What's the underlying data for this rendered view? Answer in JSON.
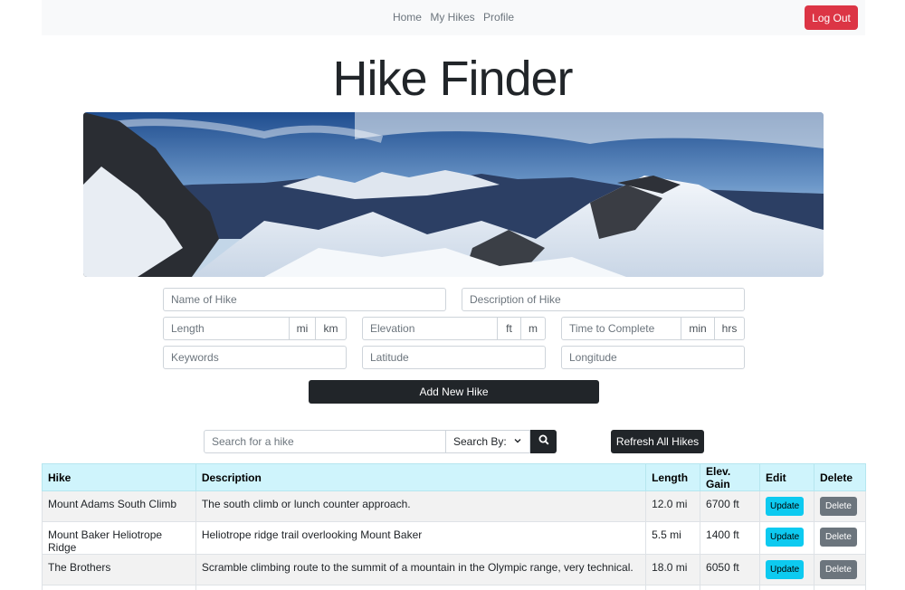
{
  "nav": {
    "links": [
      "Home",
      "My Hikes",
      "Profile"
    ],
    "logout_label": "Log Out"
  },
  "page_title": "Hike Finder",
  "form": {
    "name_placeholder": "Name of Hike",
    "description_placeholder": "Description of Hike",
    "length_placeholder": "Length",
    "length_units": [
      "mi",
      "km"
    ],
    "elevation_placeholder": "Elevation",
    "elevation_units": [
      "ft",
      "m"
    ],
    "time_placeholder": "Time to Complete",
    "time_units": [
      "min",
      "hrs"
    ],
    "keywords_placeholder": "Keywords",
    "latitude_placeholder": "Latitude",
    "longitude_placeholder": "Longitude",
    "add_label": "Add New Hike"
  },
  "search": {
    "placeholder": "Search for a hike",
    "select_label": "Search By:",
    "refresh_label": "Refresh All Hikes"
  },
  "table": {
    "headers": [
      "Hike",
      "Description",
      "Length",
      "Elev. Gain",
      "Edit",
      "Delete"
    ],
    "update_label": "Update",
    "delete_label": "Delete",
    "rows": [
      {
        "hike": "Mount Adams South Climb",
        "description": "The south climb or lunch counter approach.",
        "length": "12.0 mi",
        "elev": "6700 ft"
      },
      {
        "hike": "Mount Baker Heliotrope Ridge",
        "description": "Heliotrope ridge trail overlooking Mount Baker",
        "length": "5.5 mi",
        "elev": "1400 ft"
      },
      {
        "hike": "The Brothers",
        "description": "Scramble climbing route to the summit of a mountain in the Olympic range, very technical.",
        "length": "18.0 mi",
        "elev": "6050 ft"
      }
    ]
  },
  "colors": {
    "danger": "#dc3545",
    "dark": "#212529",
    "info": "#0dcaf0",
    "table_header": "#cff4fc"
  }
}
